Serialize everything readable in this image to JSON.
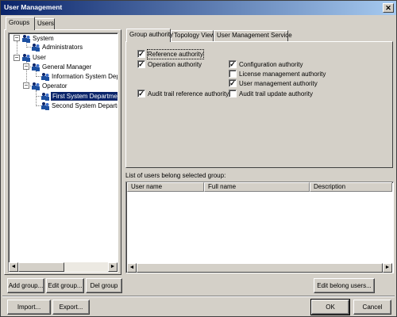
{
  "window": {
    "title": "User Management",
    "close_glyph": "✕"
  },
  "left_tabs": [
    {
      "label": "Groups",
      "active": true
    },
    {
      "label": "Users",
      "active": false
    }
  ],
  "tree": {
    "nodes": [
      {
        "label": "System",
        "expander": "−"
      },
      {
        "label": "Administrators"
      },
      {
        "label": "User",
        "expander": "−"
      },
      {
        "label": "General Manager",
        "expander": "−"
      },
      {
        "label": "Information System Department"
      },
      {
        "label": "Operator",
        "expander": "−"
      },
      {
        "label": "First System Department",
        "selected": true
      },
      {
        "label": "Second System Department"
      }
    ]
  },
  "right_tabs": [
    {
      "label": "Group authority",
      "active": true
    },
    {
      "label": "Topology View",
      "active": false
    },
    {
      "label": "User Management Service",
      "active": false
    }
  ],
  "authorities": [
    {
      "label": "Reference authority",
      "checked": true,
      "focused": true
    },
    {
      "label": "Operation authority",
      "checked": true
    },
    {
      "label": "Configuration authority",
      "checked": true
    },
    {
      "label": "License management authority",
      "checked": false
    },
    {
      "label": "User management authority",
      "checked": true
    },
    {
      "label": "Audit trail reference authority",
      "checked": true
    },
    {
      "label": "Audit trail update authority",
      "checked": false
    }
  ],
  "users_list": {
    "caption": "List of users belong selected group:",
    "columns": [
      "User name",
      "Full name",
      "Description"
    ],
    "rows": []
  },
  "scroll_glyphs": {
    "left": "◄",
    "right": "►"
  },
  "buttons": {
    "add_group": "Add group...",
    "edit_group": "Edit group...",
    "del_group": "Del group",
    "edit_belong_users": "Edit belong users...",
    "import": "Import...",
    "export": "Export...",
    "ok": "OK",
    "cancel": "Cancel"
  }
}
